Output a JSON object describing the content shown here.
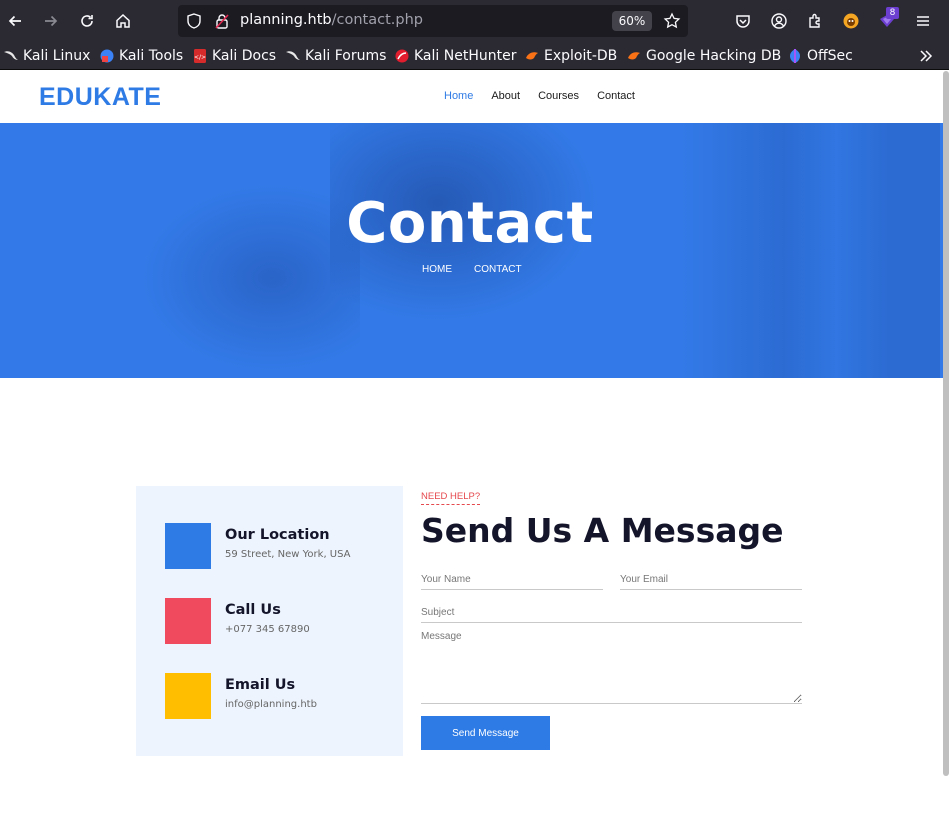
{
  "browser": {
    "url_host": "planning.htb",
    "url_path": "/contact.php",
    "zoom": "60%",
    "extension_badge": "8",
    "bookmarks": [
      {
        "label": "Kali Linux",
        "icon": "kali-dragon-icon"
      },
      {
        "label": "Kali Tools",
        "icon": "kali-tools-icon"
      },
      {
        "label": "Kali Docs",
        "icon": "kali-docs-icon"
      },
      {
        "label": "Kali Forums",
        "icon": "kali-dragon-icon"
      },
      {
        "label": "Kali NetHunter",
        "icon": "nethunter-icon"
      },
      {
        "label": "Exploit-DB",
        "icon": "exploit-db-icon"
      },
      {
        "label": "Google Hacking DB",
        "icon": "ghdb-icon"
      },
      {
        "label": "OffSec",
        "icon": "offsec-icon"
      }
    ]
  },
  "site": {
    "logo": "EDUKATE",
    "nav": [
      {
        "label": "Home",
        "active": true
      },
      {
        "label": "About",
        "active": false
      },
      {
        "label": "Courses",
        "active": false
      },
      {
        "label": "Contact",
        "active": false
      }
    ]
  },
  "hero": {
    "title": "Contact",
    "breadcrumb": [
      "HOME",
      "CONTACT"
    ]
  },
  "contact_info": [
    {
      "title": "Our Location",
      "value": "59 Street, New York, USA",
      "color": "#2f7be5"
    },
    {
      "title": "Call Us",
      "value": "+077 345 67890",
      "color": "#ef4a5e"
    },
    {
      "title": "Email Us",
      "value": "info@planning.htb",
      "color": "#ffbf00"
    }
  ],
  "form": {
    "eyebrow": "NEED HELP?",
    "title": "Send Us A Message",
    "name_placeholder": "Your Name",
    "email_placeholder": "Your Email",
    "subject_placeholder": "Subject",
    "message_placeholder": "Message",
    "submit_label": "Send Message"
  },
  "colors": {
    "accent": "#2f7be5",
    "danger": "#e5484d",
    "warning": "#ffbf00"
  }
}
